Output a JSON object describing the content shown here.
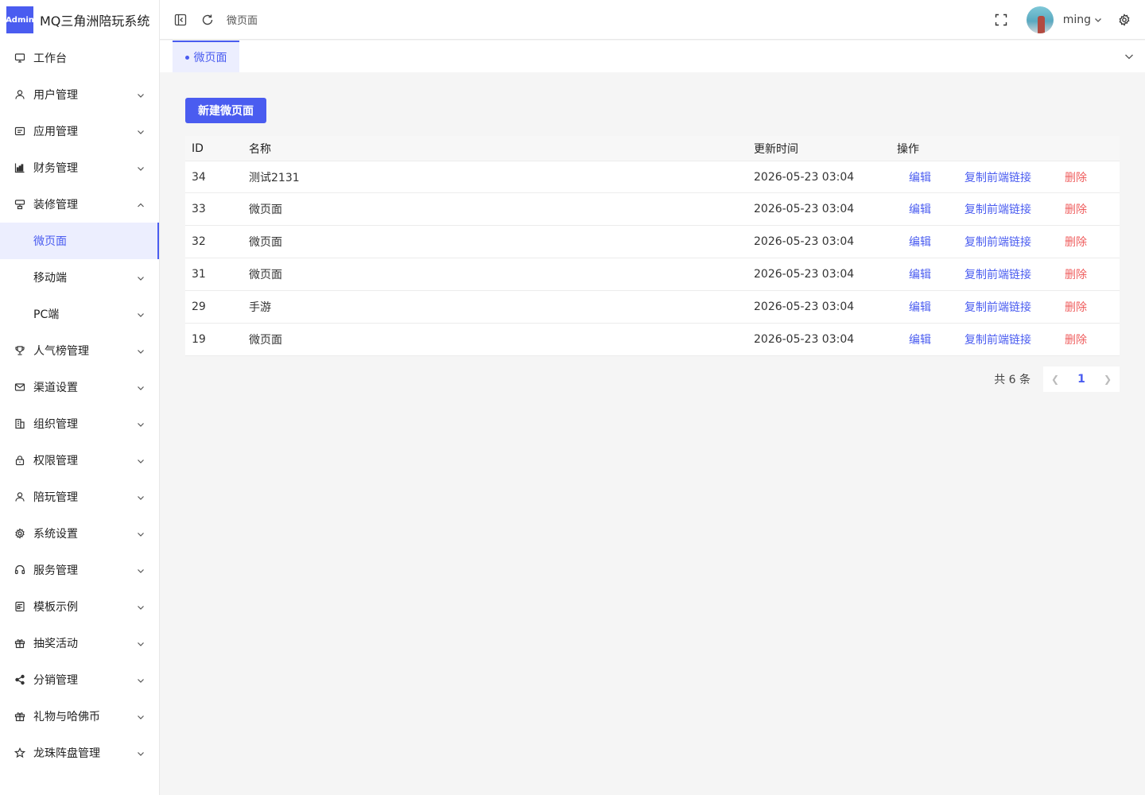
{
  "app": {
    "badge": "Admin",
    "title": "MQ三角洲陪玩系统"
  },
  "header": {
    "breadcrumb": "微页面",
    "username": "ming"
  },
  "sidebar": {
    "items": [
      {
        "label": "工作台",
        "icon": "monitor-icon",
        "chevron": ""
      },
      {
        "label": "用户管理",
        "icon": "user-icon",
        "chevron": "down"
      },
      {
        "label": "应用管理",
        "icon": "app-icon",
        "chevron": "down"
      },
      {
        "label": "财务管理",
        "icon": "chart-icon",
        "chevron": "down"
      },
      {
        "label": "装修管理",
        "icon": "decor-icon",
        "chevron": "up"
      },
      {
        "label": "微页面",
        "icon": "",
        "chevron": "",
        "sub": true,
        "active": true
      },
      {
        "label": "移动端",
        "icon": "",
        "chevron": "down",
        "sub": true
      },
      {
        "label": "PC端",
        "icon": "",
        "chevron": "down",
        "sub": true
      },
      {
        "label": "人气榜管理",
        "icon": "trophy-icon",
        "chevron": "down"
      },
      {
        "label": "渠道设置",
        "icon": "mail-icon",
        "chevron": "down"
      },
      {
        "label": "组织管理",
        "icon": "building-icon",
        "chevron": "down"
      },
      {
        "label": "权限管理",
        "icon": "lock-icon",
        "chevron": "down"
      },
      {
        "label": "陪玩管理",
        "icon": "user-icon",
        "chevron": "down"
      },
      {
        "label": "系统设置",
        "icon": "gear-icon",
        "chevron": "down"
      },
      {
        "label": "服务管理",
        "icon": "headset-icon",
        "chevron": "down"
      },
      {
        "label": "模板示例",
        "icon": "template-icon",
        "chevron": "down"
      },
      {
        "label": "抽奖活动",
        "icon": "gift-icon",
        "chevron": "down"
      },
      {
        "label": "分销管理",
        "icon": "share-icon",
        "chevron": "down"
      },
      {
        "label": "礼物与哈佛币",
        "icon": "gift-icon",
        "chevron": "down"
      },
      {
        "label": "龙珠阵盘管理",
        "icon": "star-icon",
        "chevron": "down"
      }
    ]
  },
  "tabs": [
    {
      "label": "微页面"
    }
  ],
  "main": {
    "new_button": "新建微页面",
    "columns": {
      "id": "ID",
      "name": "名称",
      "time": "更新时间",
      "ops": "操作"
    },
    "rows": [
      {
        "id": "34",
        "name": "测试2131",
        "time": "2026-05-23 03:04"
      },
      {
        "id": "33",
        "name": "微页面",
        "time": "2026-05-23 03:04"
      },
      {
        "id": "32",
        "name": "微页面",
        "time": "2026-05-23 03:04"
      },
      {
        "id": "31",
        "name": "微页面",
        "time": "2026-05-23 03:04"
      },
      {
        "id": "29",
        "name": "手游",
        "time": "2026-05-23 03:04"
      },
      {
        "id": "19",
        "name": "微页面",
        "time": "2026-05-23 03:04"
      }
    ],
    "ops": {
      "edit": "编辑",
      "copy": "复制前端链接",
      "delete": "删除"
    },
    "pagination": {
      "total": "共 6 条",
      "current": "1"
    }
  },
  "colors": {
    "accent": "#4a5cf0",
    "danger": "#ef5d5d"
  }
}
